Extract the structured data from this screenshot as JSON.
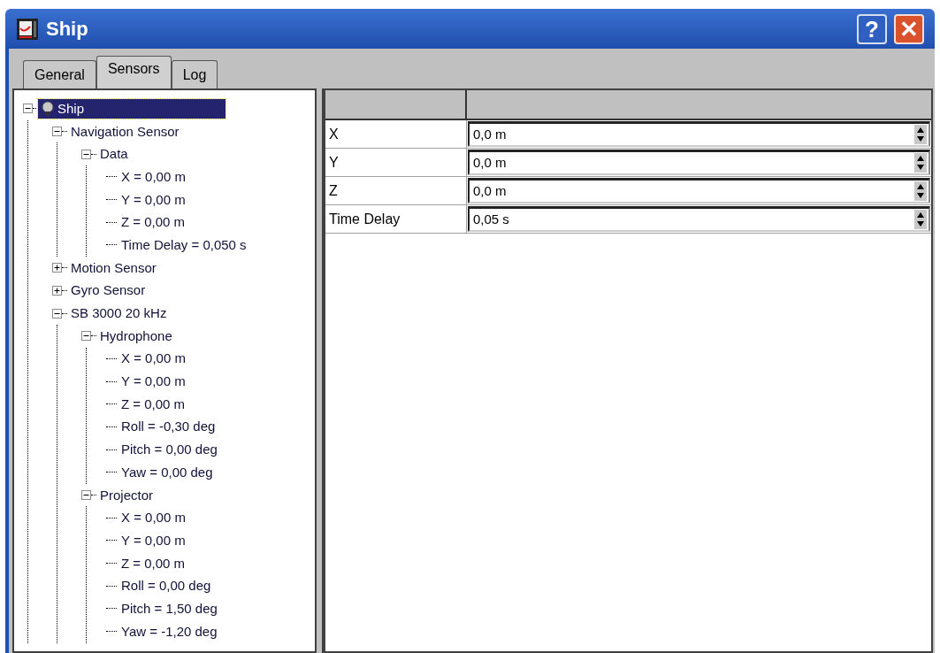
{
  "window": {
    "title": "Ship"
  },
  "title_buttons": [
    {
      "kind": "help",
      "label": "?"
    },
    {
      "kind": "close",
      "label": "✕"
    }
  ],
  "tabs": [
    {
      "label": "General",
      "selected": false
    },
    {
      "label": "Sensors",
      "selected": true
    },
    {
      "label": "Log",
      "selected": false
    }
  ],
  "tree": [
    {
      "label": "Ship",
      "selected": true,
      "expanded": true,
      "children": [
        {
          "label": "Navigation Sensor",
          "selected": false,
          "expanded": true,
          "children": [
            {
              "label": "Data",
              "selected": false,
              "expanded": true,
              "children": [
                {
                  "label": "X = 0,00 m",
                  "selected": false
                },
                {
                  "label": "Y = 0,00 m",
                  "selected": false
                },
                {
                  "label": "Z = 0,00 m",
                  "selected": false
                },
                {
                  "label": "Time Delay = 0,050 s",
                  "selected": false
                }
              ]
            }
          ]
        },
        {
          "label": "Motion Sensor",
          "selected": false,
          "expanded": false
        },
        {
          "label": "Gyro Sensor",
          "selected": false,
          "expanded": false
        },
        {
          "label": "SB 3000 20 kHz",
          "selected": false,
          "expanded": true,
          "children": [
            {
              "label": "Hydrophone",
              "selected": false,
              "expanded": true,
              "children": [
                {
                  "label": "X = 0,00 m",
                  "selected": false
                },
                {
                  "label": "Y = 0,00 m",
                  "selected": false
                },
                {
                  "label": "Z = 0,00 m",
                  "selected": false
                },
                {
                  "label": "Roll = -0,30 deg",
                  "selected": false
                },
                {
                  "label": "Pitch = 0,00 deg",
                  "selected": false
                },
                {
                  "label": "Yaw = 0,00 deg",
                  "selected": false
                }
              ]
            },
            {
              "label": "Projector",
              "selected": false,
              "expanded": true,
              "children": [
                {
                  "label": "X = 0,00 m",
                  "selected": false
                },
                {
                  "label": "Y = 0,00 m",
                  "selected": false
                },
                {
                  "label": "Z = 0,00 m",
                  "selected": false
                },
                {
                  "label": "Roll = 0,00 deg",
                  "selected": false
                },
                {
                  "label": "Pitch = 1,50 deg",
                  "selected": false
                },
                {
                  "label": "Yaw = -1,20 deg",
                  "selected": false
                }
              ]
            }
          ]
        }
      ]
    }
  ],
  "properties": {
    "rows": [
      {
        "label": "X",
        "value": "0,0 m"
      },
      {
        "label": "Y",
        "value": "0,0 m"
      },
      {
        "label": "Z",
        "value": "0,0 m"
      },
      {
        "label": "Time Delay",
        "value": "0,05 s"
      }
    ]
  }
}
